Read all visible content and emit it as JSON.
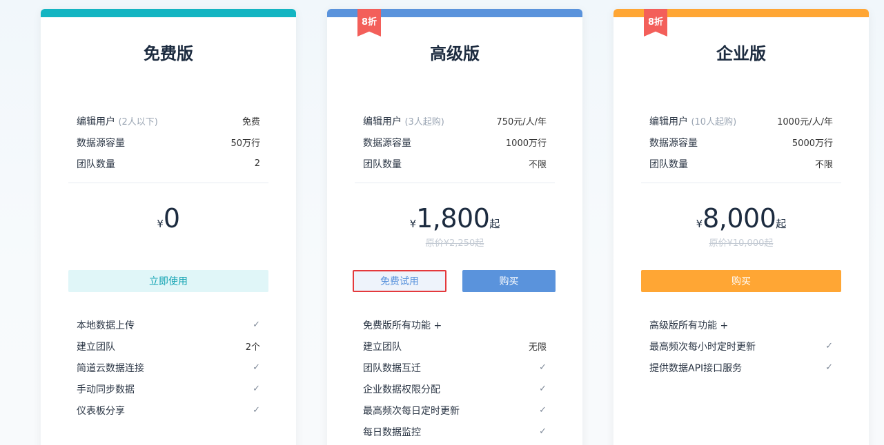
{
  "plans": [
    {
      "title": "免费版",
      "specs": [
        {
          "label": "编辑用户",
          "note": "(2人以下)",
          "value": "免费"
        },
        {
          "label": "数据源容量",
          "note": "",
          "value": "50万行"
        },
        {
          "label": "团队数量",
          "note": "",
          "value": "2"
        }
      ],
      "currency": "¥",
      "price": "0",
      "suffix": "",
      "original": "",
      "buttons": [
        {
          "label": "立即使用"
        }
      ],
      "features": [
        {
          "label": "本地数据上传",
          "value": "✓"
        },
        {
          "label": "建立团队",
          "value": "2个"
        },
        {
          "label": "简道云数据连接",
          "value": "✓"
        },
        {
          "label": "手动同步数据",
          "value": "✓"
        },
        {
          "label": "仪表板分享",
          "value": "✓"
        }
      ]
    },
    {
      "title": "高级版",
      "ribbon": "8折",
      "specs": [
        {
          "label": "编辑用户",
          "note": "(3人起购)",
          "value": "750元/人/年"
        },
        {
          "label": "数据源容量",
          "note": "",
          "value": "1000万行"
        },
        {
          "label": "团队数量",
          "note": "",
          "value": "不限"
        }
      ],
      "currency": "¥",
      "price": "1,800",
      "suffix": "起",
      "original": "原价¥2,250起",
      "buttons": [
        {
          "label": "免费试用"
        },
        {
          "label": "购买"
        }
      ],
      "features": [
        {
          "label": "免费版所有功能 +",
          "value": ""
        },
        {
          "label": "建立团队",
          "value": "无限"
        },
        {
          "label": "团队数据互迁",
          "value": "✓"
        },
        {
          "label": "企业数据权限分配",
          "value": "✓"
        },
        {
          "label": "最高频次每日定时更新",
          "value": "✓"
        },
        {
          "label": "每日数据监控",
          "value": "✓"
        }
      ]
    },
    {
      "title": "企业版",
      "ribbon": "8折",
      "specs": [
        {
          "label": "编辑用户",
          "note": "(10人起购)",
          "value": "1000元/人/年"
        },
        {
          "label": "数据源容量",
          "note": "",
          "value": "5000万行"
        },
        {
          "label": "团队数量",
          "note": "",
          "value": "不限"
        }
      ],
      "currency": "¥",
      "price": "8,000",
      "suffix": "起",
      "original": "原价¥10,000起",
      "buttons": [
        {
          "label": "购买"
        }
      ],
      "features": [
        {
          "label": "高级版所有功能 +",
          "value": ""
        },
        {
          "label": "最高频次每小时定时更新",
          "value": "✓"
        },
        {
          "label": "提供数据API接口服务",
          "value": "✓"
        }
      ]
    }
  ],
  "colors": {
    "free_accent": "#14b5c2",
    "pro_accent": "#5a93dc",
    "enterprise_accent": "#ffa634",
    "ribbon": "#f35f5a",
    "highlight_border": "#e4393c"
  }
}
